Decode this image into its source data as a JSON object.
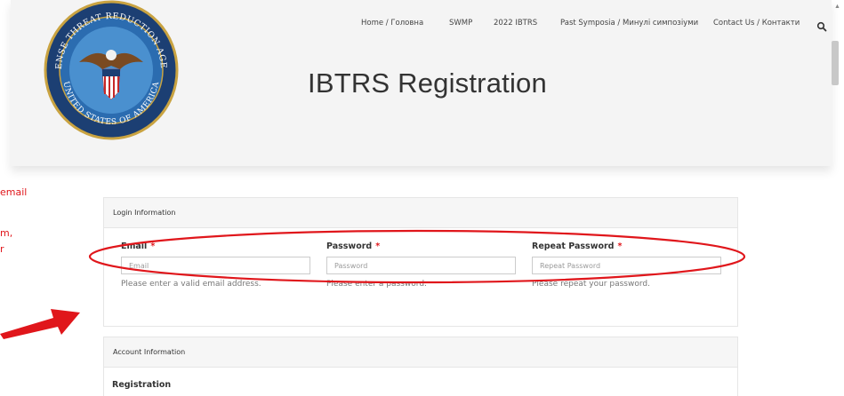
{
  "header": {
    "title": "IBTRS Registration",
    "nav": [
      "Home / Головна",
      "SWMP",
      "2022 IBTRS",
      "Past Symposia / Минулі симпозіуми",
      "Contact Us / Контакти"
    ],
    "logo": {
      "top_text": "DEFENSE THREAT REDUCTION AGENCY",
      "bottom_text": "UNITED STATES OF AMERICA"
    }
  },
  "annotation": {
    "left_text": [
      "email",
      "m,",
      "r"
    ],
    "color": "#e0161b"
  },
  "login_panel": {
    "heading": "Login Information",
    "fields": [
      {
        "label": "Email",
        "required": "*",
        "placeholder": "Email",
        "help": "Please enter a valid email address."
      },
      {
        "label": "Password",
        "required": "*",
        "placeholder": "Password",
        "help": "Please enter a password."
      },
      {
        "label": "Repeat Password",
        "required": "*",
        "placeholder": "Repeat Password",
        "help": "Please repeat your password."
      }
    ]
  },
  "account_panel": {
    "heading": "Account Information",
    "section_label": "Registration"
  },
  "icons": {
    "search": "search-icon",
    "arrow": "red-arrow-icon",
    "ellipse": "red-ellipse-annotation"
  }
}
